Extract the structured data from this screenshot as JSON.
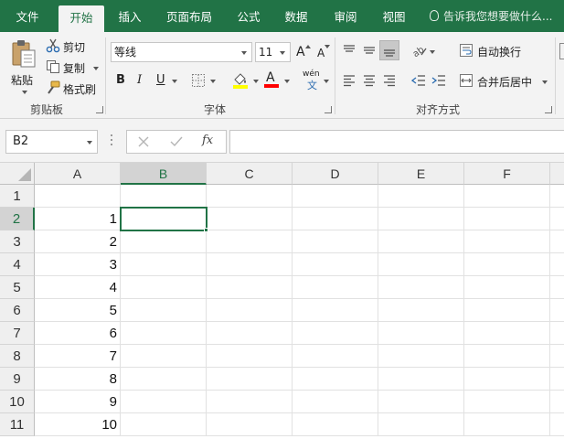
{
  "tabs": [
    {
      "label": "文件",
      "active": false
    },
    {
      "label": "开始",
      "active": true
    },
    {
      "label": "插入",
      "active": false
    },
    {
      "label": "页面布局",
      "active": false
    },
    {
      "label": "公式",
      "active": false
    },
    {
      "label": "数据",
      "active": false
    },
    {
      "label": "审阅",
      "active": false
    },
    {
      "label": "视图",
      "active": false
    }
  ],
  "tell_me": "告诉我您想要做什么...",
  "clipboard": {
    "paste": "粘贴",
    "cut": "剪切",
    "copy": "复制",
    "format_painter": "格式刷",
    "group_label": "剪贴板"
  },
  "font": {
    "font_name": "等线",
    "font_size": "11",
    "grow_label": "A",
    "shrink_label": "A",
    "bold": "B",
    "italic": "I",
    "underline": "U",
    "font_color_label": "A",
    "phonetic_label": "wén",
    "group_label": "字体"
  },
  "alignment": {
    "wrap_text": "自动换行",
    "merge_center": "合并后居中",
    "group_label": "对齐方式"
  },
  "formula_bar": {
    "name_box": "B2",
    "fx": "fx",
    "formula": ""
  },
  "columns": [
    "A",
    "B",
    "C",
    "D",
    "E",
    "F"
  ],
  "selected_column": "B",
  "rows": [
    "1",
    "2",
    "3",
    "4",
    "5",
    "6",
    "7",
    "8",
    "9",
    "10",
    "11"
  ],
  "selected_row": "2",
  "column_a_values": [
    "",
    "1",
    "2",
    "3",
    "4",
    "5",
    "6",
    "7",
    "8",
    "9",
    "10"
  ],
  "colors": {
    "accent": "#217346",
    "highlight_yellow": "#ffff00",
    "font_red": "#ff0000"
  }
}
